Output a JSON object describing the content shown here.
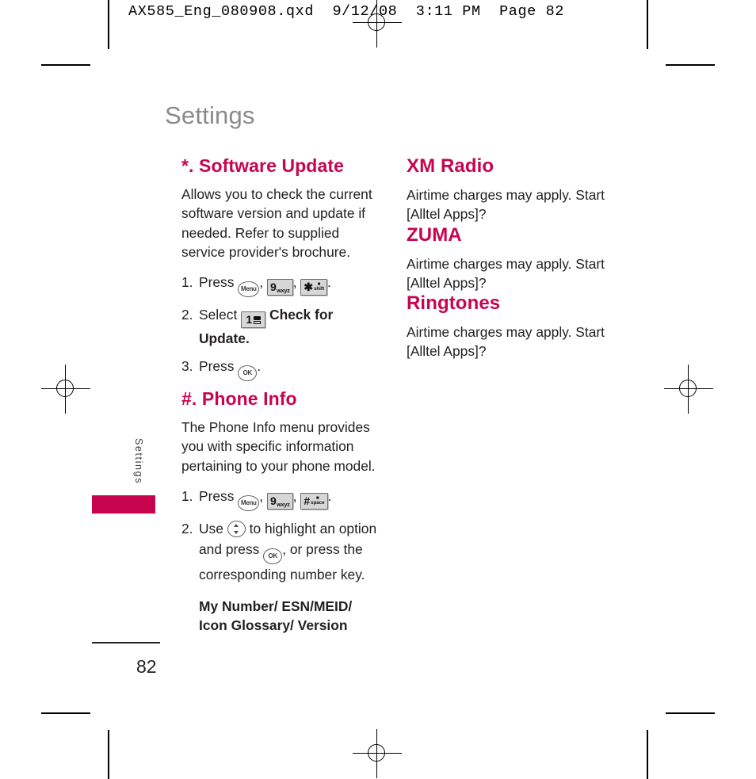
{
  "print_marks": {
    "slug_text": "AX585_Eng_080908.qxd  9/12/08  3:11 PM  Page 82"
  },
  "page": {
    "title": "Settings",
    "side_tab_label": "Settings",
    "page_number": "82",
    "accent_color": "#c8044e",
    "title_color": "#8a8a8a"
  },
  "left_column": {
    "section1": {
      "heading": "*. Software Update",
      "body": "Allows you to check the current software version and update if needed. Refer to supplied service provider's brochure.",
      "steps": [
        {
          "num": "1.",
          "text_before": "Press",
          "keys": [
            "menu-key",
            "9-wxyz-key",
            "star-shift-key"
          ],
          "text_after": "."
        },
        {
          "num": "2.",
          "text_before": "Select",
          "keys": [
            "1-voicemail-key"
          ],
          "bold_text": "Check for Update.",
          "text_after": ""
        },
        {
          "num": "3.",
          "text_before": "Press",
          "keys": [
            "ok-key"
          ],
          "text_after": "."
        }
      ]
    },
    "section2": {
      "heading": "#. Phone Info",
      "body": "The Phone Info menu provides you with specific information pertaining to your phone model.",
      "steps": [
        {
          "num": "1.",
          "text_before": "Press",
          "keys": [
            "menu-key",
            "9-wxyz-key",
            "hash-space-key"
          ],
          "text_after": "."
        },
        {
          "num": "2.",
          "text_before": "Use",
          "text_mid": "to highlight an option and press",
          "text_after": ", or press the corresponding number key."
        }
      ],
      "menu_options": "My Number/ ESN/MEID/ Icon Glossary/ Version"
    }
  },
  "right_column": {
    "sections": [
      {
        "heading": "XM Radio",
        "body": "Airtime charges may apply. Start [Alltel Apps]?"
      },
      {
        "heading": "ZUMA",
        "body": "Airtime charges may apply. Start [Alltel Apps]?"
      },
      {
        "heading": "Ringtones",
        "body": "Airtime charges may apply. Start [Alltel Apps]?"
      }
    ]
  },
  "keys": {
    "menu": "Menu",
    "ok": "OK",
    "nine_main": "9",
    "nine_sub": "wxyz",
    "one_main": "1",
    "star_main": "✱",
    "star_sub_top": "■",
    "star_sub_bottom": "shift",
    "hash_main": "#",
    "hash_sub_bottom": "space"
  }
}
